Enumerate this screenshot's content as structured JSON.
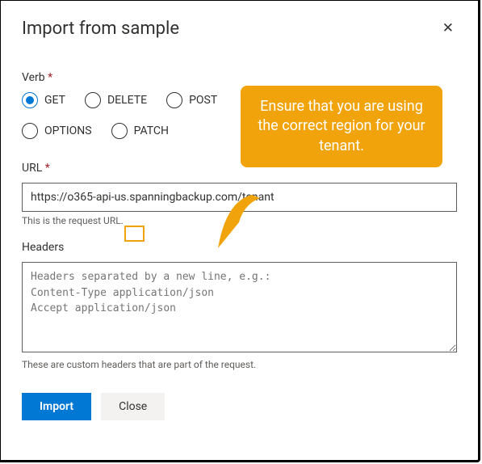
{
  "header": {
    "title": "Import from sample",
    "close_icon": "✕"
  },
  "verb": {
    "label": "Verb",
    "options": {
      "get": "GET",
      "delete": "DELETE",
      "post": "POST",
      "options": "OPTIONS",
      "patch": "PATCH"
    },
    "selected": "GET"
  },
  "url": {
    "label": "URL",
    "value": "https://o365-api-us.spanningbackup.com/tenant",
    "help": "This is the request URL."
  },
  "headers": {
    "label": "Headers",
    "placeholder": "Headers separated by a new line, e.g.:\nContent-Type application/json\nAccept application/json",
    "help": "These are custom headers that are part of the request."
  },
  "buttons": {
    "import": "Import",
    "close": "Close"
  },
  "callout": {
    "text": "Ensure that you are using the correct region for your tenant."
  }
}
